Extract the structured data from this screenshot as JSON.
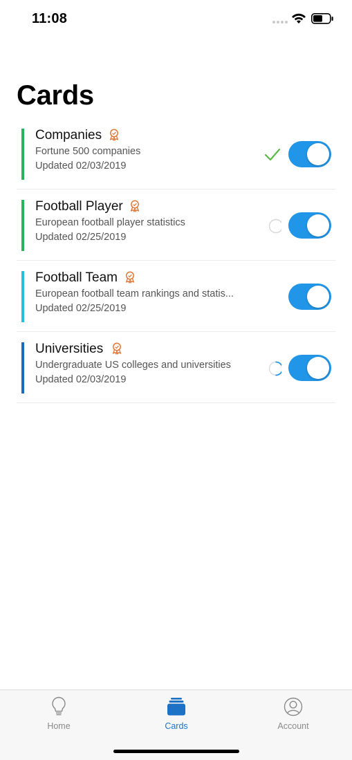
{
  "status_bar": {
    "time": "11:08"
  },
  "page": {
    "title": "Cards"
  },
  "cards": [
    {
      "name": "Companies",
      "description": "Fortune 500 companies",
      "updated": "Updated 02/03/2019",
      "accent": "#2bb35c",
      "status": "synced",
      "enabled": true
    },
    {
      "name": "Football Player",
      "description": "European football player statistics",
      "updated": "Updated 02/25/2019",
      "accent": "#2bb35c",
      "status": "pending",
      "enabled": true
    },
    {
      "name": "Football Team",
      "description": "European football team rankings and statis...",
      "updated": "Updated 02/25/2019",
      "accent": "#1fc3d6",
      "status": "none",
      "enabled": true
    },
    {
      "name": "Universities",
      "description": "Undergraduate US colleges and universities",
      "updated": "Updated 02/03/2019",
      "accent": "#1d6bb8",
      "status": "loading",
      "enabled": true
    }
  ],
  "colors": {
    "toggle_on": "#2196e8",
    "badge": "#e0793a",
    "check": "#5cb848",
    "tab_active": "#1d72c5"
  },
  "tabs": [
    {
      "label": "Home",
      "icon": "lightbulb-icon",
      "active": false
    },
    {
      "label": "Cards",
      "icon": "cards-icon",
      "active": true
    },
    {
      "label": "Account",
      "icon": "account-icon",
      "active": false
    }
  ]
}
